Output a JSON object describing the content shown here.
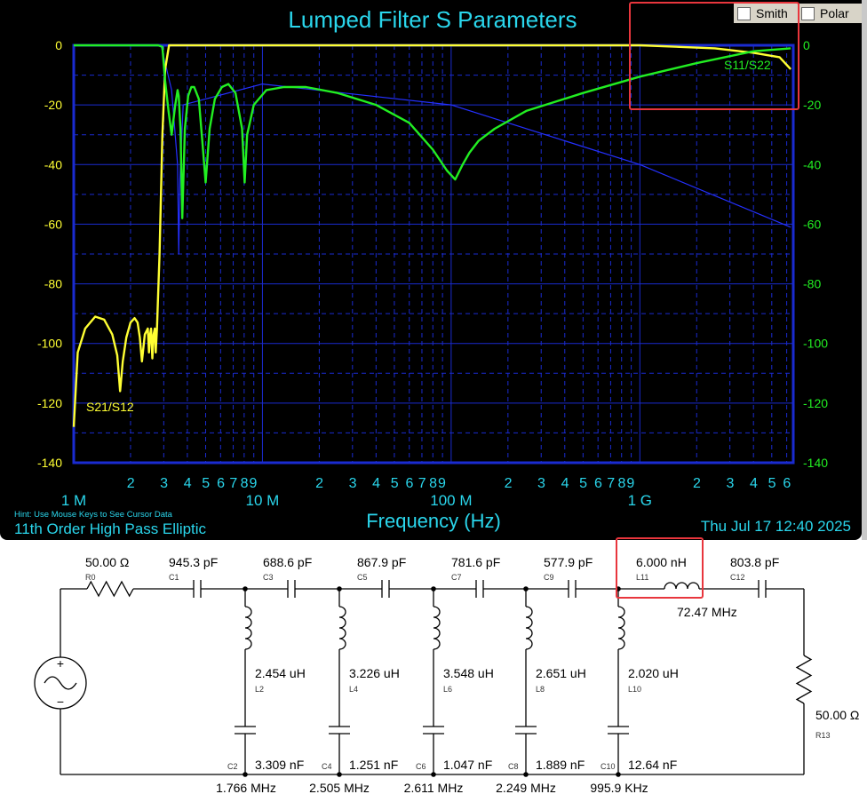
{
  "window": {
    "title": "Lumped Filter S Parameters",
    "checkboxes": [
      {
        "label": "Smith",
        "checked": false
      },
      {
        "label": "Polar",
        "checked": false
      }
    ],
    "hint": "Hint: Use Mouse Keys to See Cursor Data",
    "subtitle": "11th Order High Pass Elliptic",
    "timestamp": "Thu Jul 17 12:40 2025",
    "colors": {
      "background": "#000000",
      "grid": "#1a2bd0",
      "title": "#2ad6ec",
      "s21": "#ffff33",
      "s11": "#22ee22",
      "trace": "#2430ff",
      "highlight": "#e8363d"
    }
  },
  "chart_data": {
    "type": "line",
    "title": "Lumped Filter S Parameters",
    "xlabel": "Frequency (Hz)",
    "x_scale": "log",
    "xlim": [
      1000000,
      6500000000
    ],
    "ylim": [
      -140,
      0
    ],
    "y_ticks_left": [
      "0",
      "-20",
      "-40",
      "-60",
      "-80",
      "-100",
      "-120",
      "-140"
    ],
    "y_ticks_right": [
      "0",
      "-20",
      "-40",
      "-60",
      "-80",
      "-100",
      "-120",
      "-140"
    ],
    "x_decade_labels": [
      "1 M",
      "10 M",
      "100 M",
      "1 G"
    ],
    "x_minor_labels": [
      "2",
      "3",
      "4",
      "5",
      "6",
      "7",
      "8",
      "9"
    ],
    "grid": true,
    "series": [
      {
        "name": "S21/S12",
        "color": "#ffff33",
        "x": [
          1000000,
          1050000,
          1150000,
          1300000,
          1450000,
          1600000,
          1700000,
          1760000,
          1820000,
          1900000,
          2000000,
          2100000,
          2180000,
          2240000,
          2300000,
          2380000,
          2470000,
          2505000,
          2540000,
          2570000,
          2611000,
          2650000,
          2690000,
          2720000,
          2760000,
          2850000,
          2950000,
          3050000,
          3200000,
          10000000,
          100000000,
          1000000000,
          2500000000,
          4000000000,
          5500000000,
          6300000000
        ],
        "y": [
          -128,
          -103,
          -95,
          -91,
          -92,
          -97,
          -104,
          -116,
          -106,
          -98,
          -93,
          -91.5,
          -93,
          -98,
          -106,
          -97,
          -95,
          -103,
          -97,
          -95,
          -105,
          -97,
          -95,
          -103,
          -95,
          -70,
          -30,
          -8,
          0,
          0,
          0,
          0,
          -1,
          -2.5,
          -4,
          -8
        ]
      },
      {
        "name": "S11/S22",
        "color": "#22ee22",
        "x": [
          1000000,
          2800000,
          2950000,
          3050000,
          3180000,
          3300000,
          3450000,
          3550000,
          3600000,
          3680000,
          3760000,
          3880000,
          4040000,
          4200000,
          4350000,
          4600000,
          4800000,
          5000000,
          5250000,
          5600000,
          6100000,
          6600000,
          7200000,
          7800000,
          8050000,
          8300000,
          9000000,
          10500000,
          13000000,
          17000000,
          25000000,
          40000000,
          60000000,
          80000000,
          95000000,
          105000000,
          115000000,
          125000000,
          140000000,
          170000000,
          250000000,
          500000000,
          1000000000,
          2000000000,
          4000000000,
          6300000000
        ],
        "y": [
          0,
          0,
          -0.5,
          -12,
          -22,
          -30,
          -20,
          -15,
          -17,
          -28,
          -58,
          -28,
          -17,
          -14,
          -14,
          -18,
          -32,
          -46,
          -28,
          -18,
          -14,
          -13,
          -16,
          -28,
          -46,
          -30,
          -20,
          -15,
          -14,
          -14,
          -16,
          -20,
          -26,
          -35,
          -42,
          -45,
          -40,
          -36,
          -32,
          -28,
          -22,
          -16,
          -10.5,
          -6,
          -2,
          -1
        ]
      },
      {
        "name": "",
        "color": "#2430ff",
        "x": [
          1000000,
          2900000,
          3300000,
          3550000,
          3600000,
          3650000,
          3800000,
          10000000,
          100000000,
          1000000000,
          6300000000
        ],
        "y": [
          0,
          0,
          -15,
          -40,
          -70,
          -45,
          -20,
          -13,
          -20,
          -40,
          -61
        ]
      }
    ]
  },
  "schematic": {
    "source": {
      "label": "50.00 Ω",
      "ref": "R0"
    },
    "load": {
      "label": "50.00 Ω",
      "ref": "R13"
    },
    "series": [
      {
        "ref": "C1",
        "value": "945.3 pF"
      },
      {
        "ref": "C3",
        "value": "688.6 pF"
      },
      {
        "ref": "C5",
        "value": "867.9 pF"
      },
      {
        "ref": "C7",
        "value": "781.6 pF"
      },
      {
        "ref": "C9",
        "value": "577.9 pF"
      },
      {
        "ref": "L11",
        "value": "6.000 nH",
        "resonance": "72.47 MHz"
      },
      {
        "ref": "C12",
        "value": "803.8 pF"
      }
    ],
    "shunts": [
      {
        "l_ref": "L2",
        "l_value": "2.454 uH",
        "c_ref": "C2",
        "c_value": "3.309 nF",
        "freq": "1.766 MHz"
      },
      {
        "l_ref": "L4",
        "l_value": "3.226 uH",
        "c_ref": "C4",
        "c_value": "1.251 nF",
        "freq": "2.505 MHz"
      },
      {
        "l_ref": "L6",
        "l_value": "3.548 uH",
        "c_ref": "C6",
        "c_value": "1.047 nF",
        "freq": "2.611 MHz"
      },
      {
        "l_ref": "L8",
        "l_value": "2.651 uH",
        "c_ref": "C8",
        "c_value": "1.889 nF",
        "freq": "2.249 MHz"
      },
      {
        "l_ref": "L10",
        "l_value": "2.020 uH",
        "c_ref": "C10",
        "c_value": "12.64 nF",
        "freq": "995.9 KHz"
      }
    ]
  }
}
